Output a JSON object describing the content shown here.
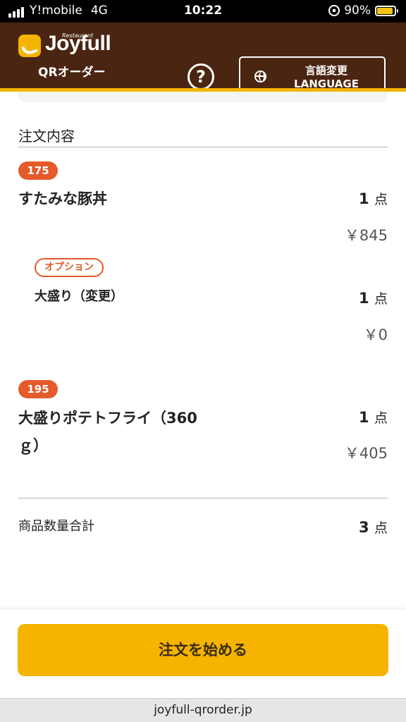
{
  "status_bar": {
    "carrier": "Y!mobile",
    "network": "4G",
    "time": "10:22",
    "battery_percent": "90%",
    "battery_level": 0.9,
    "battery_color": "#f7c41a"
  },
  "header": {
    "logo_small": "Restaurant",
    "logo_text": "Joyfull",
    "logo_sub": "QRオーダー",
    "help_icon": "?",
    "lang_button_line1": "言語変更",
    "lang_button_line2": "LANGUAGE",
    "bg_color": "#4a2511",
    "accent_color": "#f5b400"
  },
  "order": {
    "section_title": "注文内容",
    "items": [
      {
        "number": "175",
        "name": "すたみな豚丼",
        "qty": "1",
        "unit": "点",
        "price": "￥845"
      },
      {
        "number": "195",
        "name_line1": "大盛りポテトフライ（360",
        "name_line2": "ｇ）",
        "qty": "1",
        "unit": "点",
        "price": "￥405"
      }
    ],
    "option": {
      "badge": "オプション",
      "name": "大盛り（変更）",
      "qty": "1",
      "unit": "点",
      "price": "￥0"
    },
    "total_label": "商品数量合計",
    "total_qty": "3",
    "total_unit": "点"
  },
  "footer": {
    "start_button": "注文を始める",
    "url": "joyfull-qrorder.jp"
  }
}
